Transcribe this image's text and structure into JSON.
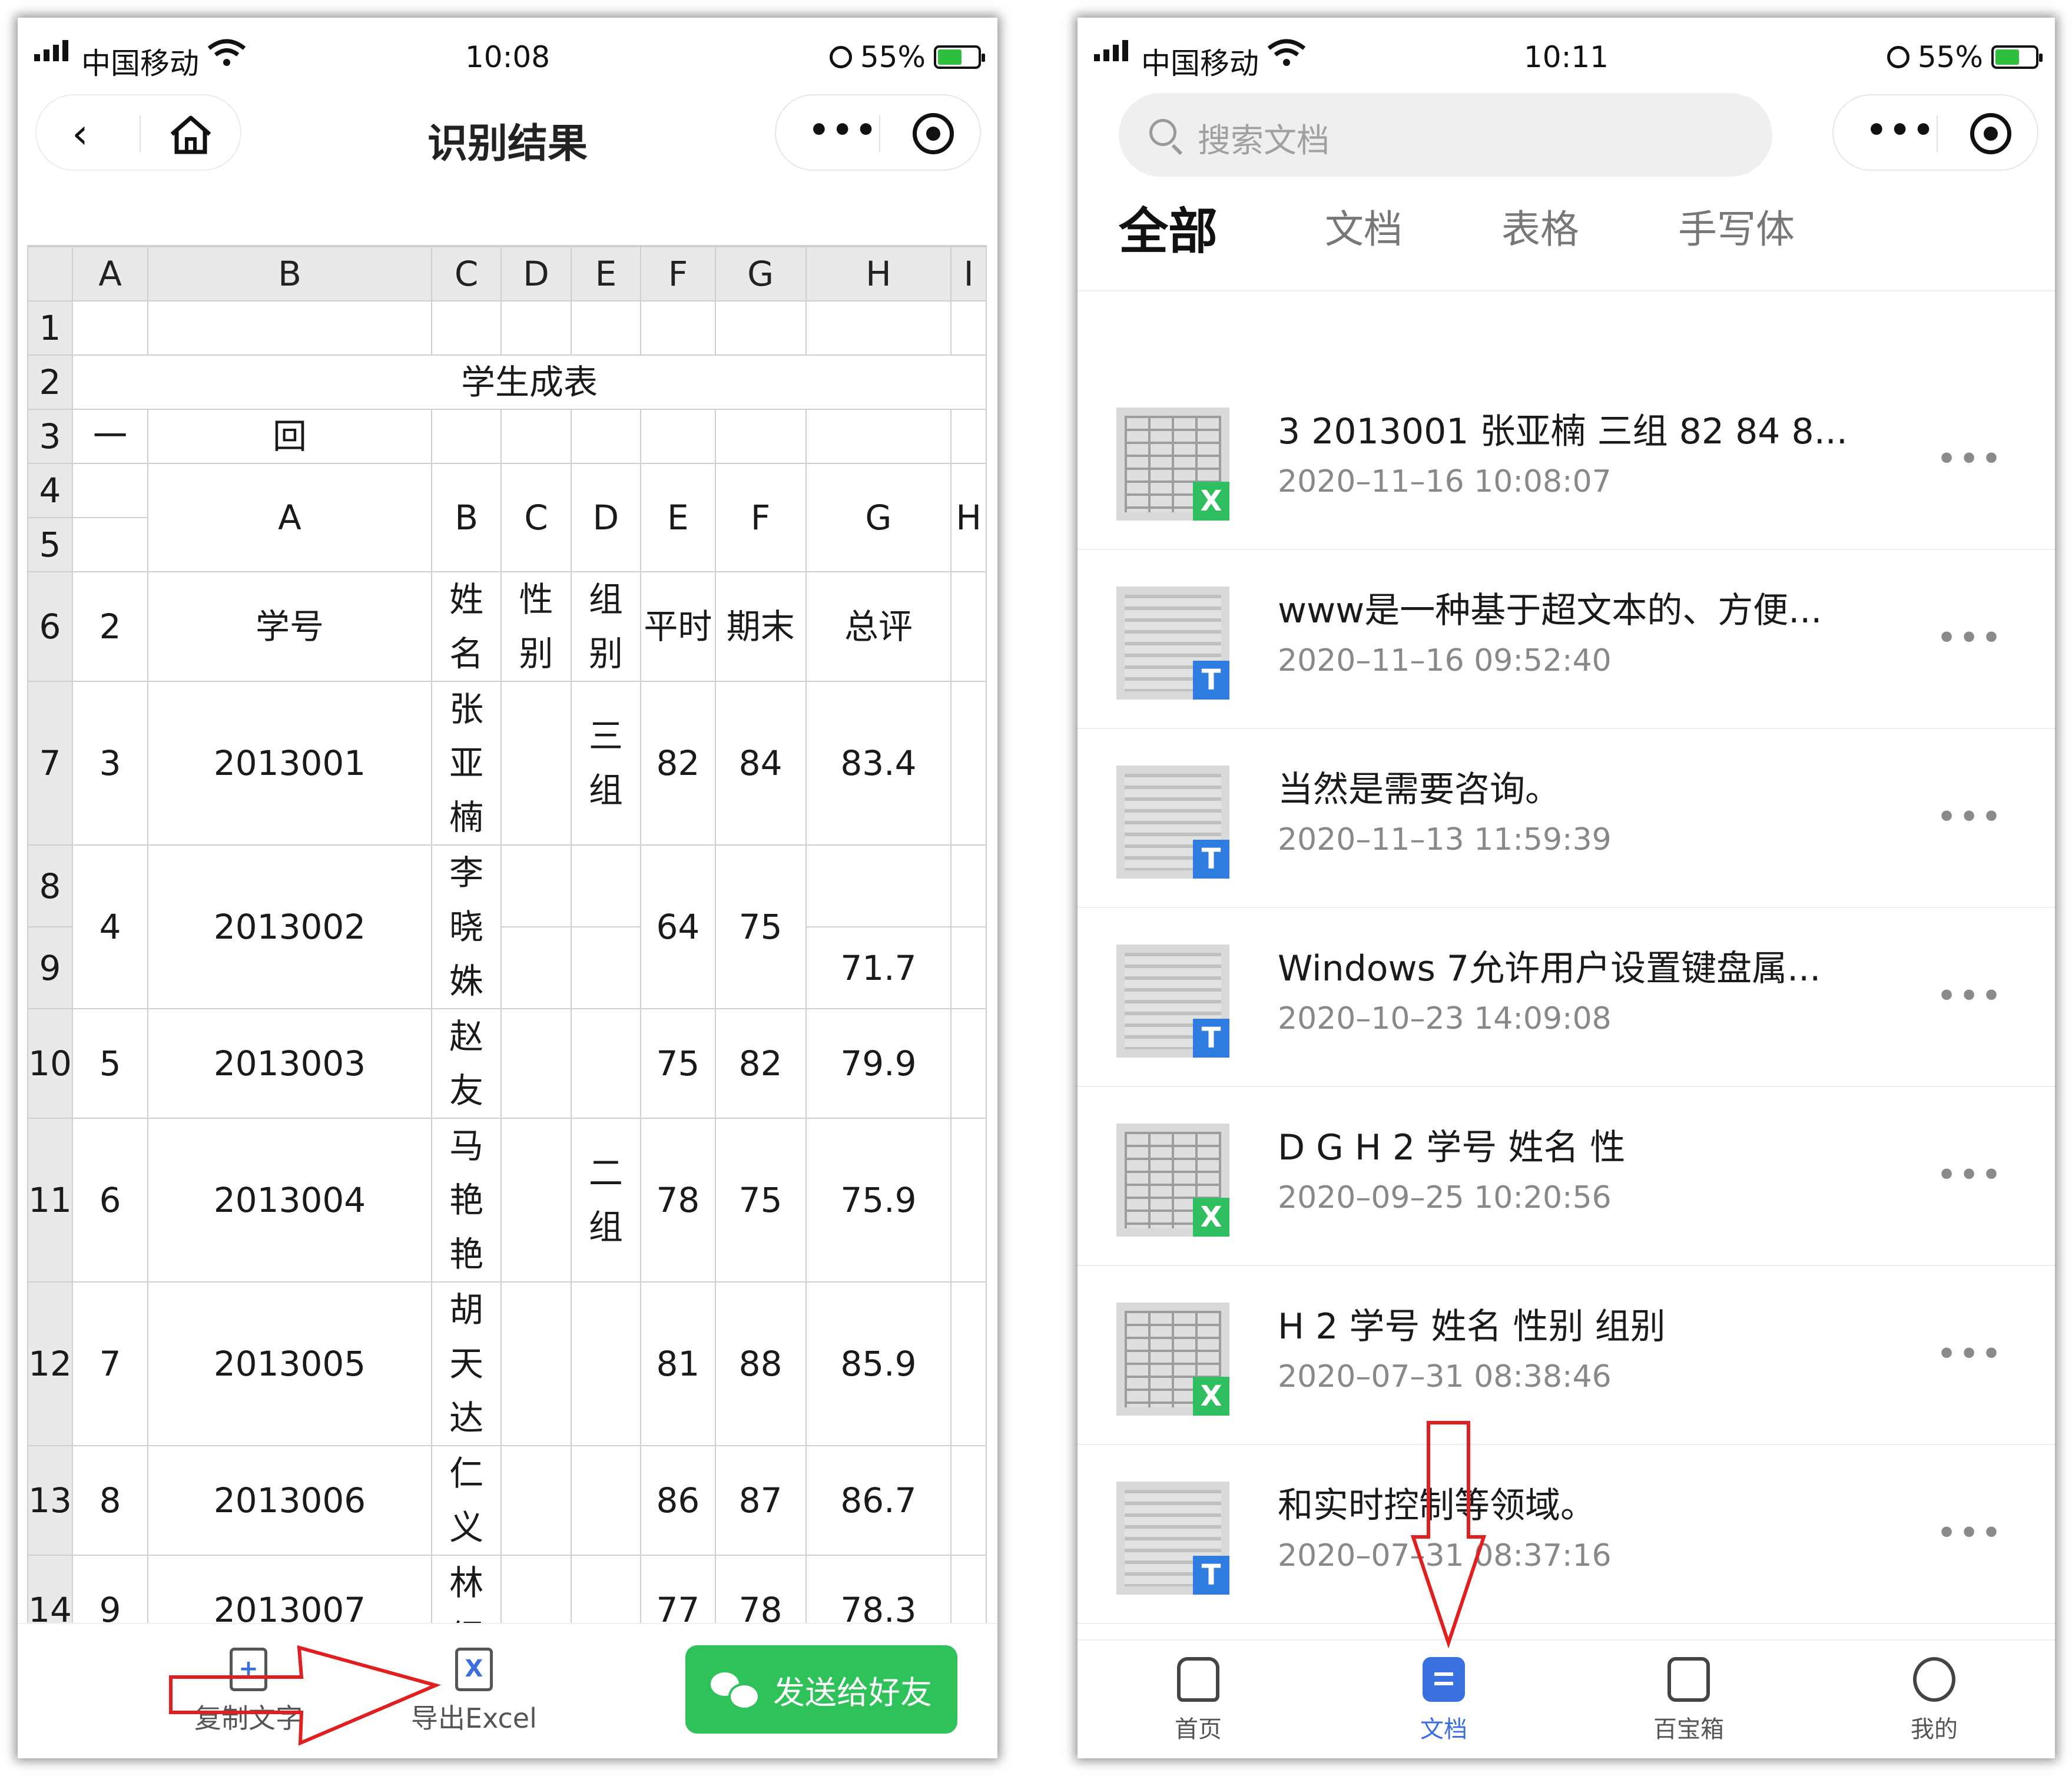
{
  "left": {
    "status": {
      "carrier": "中国移动",
      "time": "10:08",
      "battery": "55%"
    },
    "title": "识别结果",
    "sheet": {
      "col_headers": [
        "A",
        "B",
        "C",
        "D",
        "E",
        "F",
        "G",
        "H",
        "I"
      ],
      "row_headers": [
        "1",
        "2",
        "3",
        "4",
        "5",
        "6",
        "7",
        "8",
        "9",
        "10",
        "11",
        "12",
        "13",
        "14"
      ],
      "title_cell": "学生成表",
      "row3": [
        "一",
        "回"
      ],
      "row45": [
        "A",
        "B",
        "C",
        "D",
        "E",
        "F",
        "G",
        "H"
      ],
      "header_row": {
        "a": "2",
        "b": "学号",
        "c": [
          "姓",
          "名"
        ],
        "d": [
          "性",
          "别"
        ],
        "e": [
          "组",
          "别"
        ],
        "f": "平时",
        "g": "期末",
        "h": "总评"
      },
      "records": [
        {
          "a": "3",
          "b": "2013001",
          "c": [
            "张",
            "亚",
            "楠"
          ],
          "f": "82",
          "g": "84",
          "h": "83.4"
        },
        {
          "a": "4",
          "b": "2013002",
          "c": [
            "李",
            "晓",
            "姝"
          ],
          "f": "64",
          "g": "75",
          "h": "71.7"
        },
        {
          "a": "5",
          "b": "2013003",
          "c": [
            "赵",
            "友"
          ],
          "f": "75",
          "g": "82",
          "h": "79.9"
        },
        {
          "a": "6",
          "b": "2013004",
          "c": [
            "马",
            "艳",
            "艳"
          ],
          "f": "78",
          "g": "75",
          "h": "75.9"
        },
        {
          "a": "7",
          "b": "2013005",
          "c": [
            "胡",
            "天",
            "达"
          ],
          "f": "81",
          "g": "88",
          "h": "85.9"
        },
        {
          "a": "8",
          "b": "2013006",
          "c": [
            "仁",
            "义"
          ],
          "f": "86",
          "g": "87",
          "h": "86.7"
        },
        {
          "a": "9",
          "b": "2013007",
          "c": [
            "林",
            "绍"
          ],
          "f": "77",
          "g": "78",
          "h": "78.3"
        }
      ],
      "groups": {
        "first": [
          "三",
          "组"
        ],
        "second": [
          "二",
          "组"
        ]
      }
    },
    "bottom": {
      "copy_label": "复制文字",
      "excel_label": "导出Excel",
      "excel_icon_letter": "X",
      "send_label": "发送给好友"
    }
  },
  "right": {
    "status": {
      "carrier": "中国移动",
      "time": "10:11",
      "battery": "55%"
    },
    "search_placeholder": "搜索文档",
    "tabs": [
      "全部",
      "文档",
      "表格",
      "手写体"
    ],
    "documents": [
      {
        "title": "3 2013001 张亚楠 三组 82 84 8...",
        "date": "2020–11–16 10:08:07",
        "type": "X"
      },
      {
        "title": "www是一种基于超文本的、方便...",
        "date": "2020–11–16 09:52:40",
        "type": "T"
      },
      {
        "title": "当然是需要咨询。",
        "date": "2020–11–13 11:59:39",
        "type": "T"
      },
      {
        "title": "Windows 7允许用户设置键盘属...",
        "date": "2020–10–23 14:09:08",
        "type": "T"
      },
      {
        "title": "D G H 2 学号 姓名 性",
        "date": "2020–09–25 10:20:56",
        "type": "X"
      },
      {
        "title": "H 2 学号 姓名 性别 组别",
        "date": "2020–07–31 08:38:46",
        "type": "X"
      },
      {
        "title": "和实时控制等领域。",
        "date": "2020–07–31 08:37:16",
        "type": "T"
      }
    ],
    "tabbar": [
      "首页",
      "文档",
      "百宝箱",
      "我的"
    ]
  },
  "colors": {
    "accent_green": "#2fc15a",
    "accent_blue": "#3a6fe0",
    "excel_badge": "#2fbf61",
    "text_badge": "#2f7de1",
    "annotation_red": "#e02020"
  }
}
